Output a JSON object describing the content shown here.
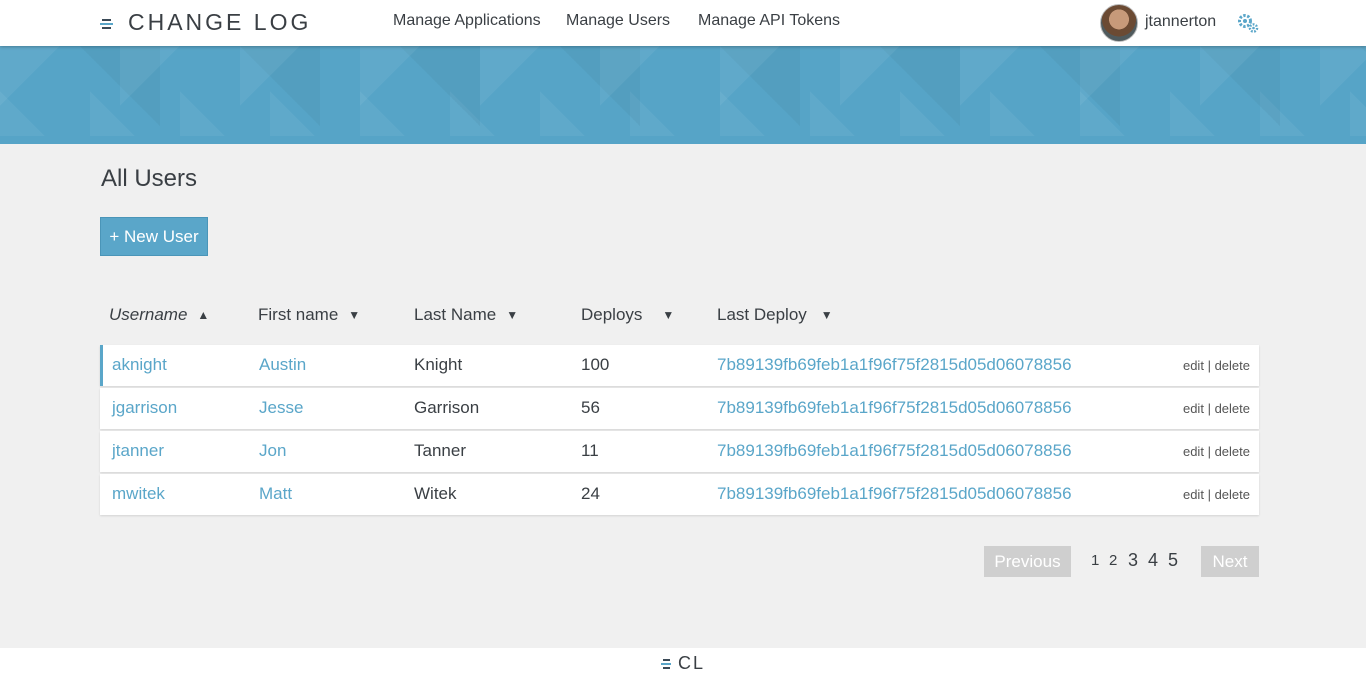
{
  "header": {
    "logo_text": "CHANGE LOG",
    "nav": [
      "Manage Applications",
      "Manage Users",
      "Manage API Tokens"
    ],
    "username": "jtannerton"
  },
  "main": {
    "title": "All Users",
    "new_button": "+ New User",
    "columns": [
      {
        "label": "Username",
        "arrow": "▲"
      },
      {
        "label": "First name",
        "arrow": "▼"
      },
      {
        "label": "Last Name",
        "arrow": "▼"
      },
      {
        "label": "Deploys",
        "arrow": "▼"
      },
      {
        "label": "Last Deploy",
        "arrow": "▼"
      }
    ],
    "rows": [
      {
        "username": "aknight",
        "first": "Austin",
        "last": "Knight",
        "deploys": "100",
        "last_deploy": "7b89139fb69feb1a1f96f75f2815d05d06078856"
      },
      {
        "username": "jgarrison",
        "first": "Jesse",
        "last": "Garrison",
        "deploys": "56",
        "last_deploy": "7b89139fb69feb1a1f96f75f2815d05d06078856"
      },
      {
        "username": "jtanner",
        "first": "Jon",
        "last": "Tanner",
        "deploys": "11",
        "last_deploy": "7b89139fb69feb1a1f96f75f2815d05d06078856"
      },
      {
        "username": "mwitek",
        "first": "Matt",
        "last": "Witek",
        "deploys": "24",
        "last_deploy": "7b89139fb69feb1a1f96f75f2815d05d06078856"
      }
    ],
    "edit_label": "edit",
    "separator": "|",
    "delete_label": "delete"
  },
  "pagination": {
    "previous": "Previous",
    "pages": [
      "1",
      "2",
      "3",
      "4",
      "5"
    ],
    "next": "Next"
  },
  "footer": {
    "logo_text": "CL"
  },
  "colors": {
    "accent": "#5aa6c9",
    "banner": "#56a4c7",
    "disabled_button": "#cfcfcf"
  },
  "icons": {
    "logo": "change-log-logo-icon",
    "settings": "gears-icon",
    "sort_up": "triangle-up-icon",
    "sort_down": "triangle-down-icon"
  }
}
